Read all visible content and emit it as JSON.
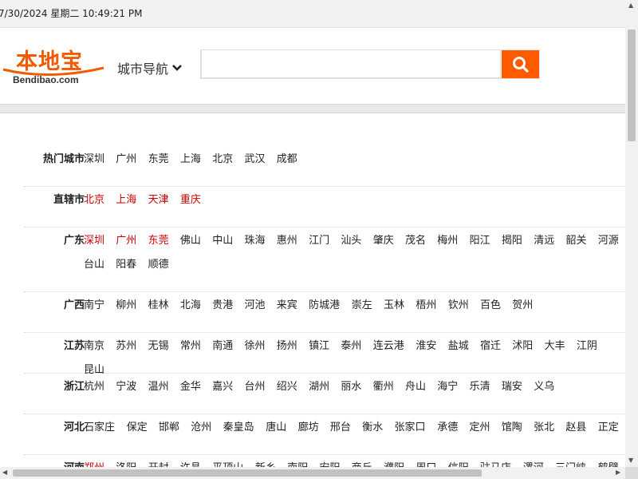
{
  "datetime": "7/30/2024 星期二 10:49:21 PM",
  "logo": {
    "cn": "本地宝",
    "en": "Bendibao.com"
  },
  "nav": {
    "city_nav_label": "城市导航"
  },
  "search": {
    "placeholder": "",
    "value": ""
  },
  "colors": {
    "accent": "#ff5a00",
    "logo": "#f05a00",
    "highlight": "#cc0000"
  },
  "rows": [
    {
      "province": "热门城市",
      "cities": [
        {
          "name": "深圳",
          "red": false
        },
        {
          "name": "广州",
          "red": false
        },
        {
          "name": "东莞",
          "red": false
        },
        {
          "name": "上海",
          "red": false
        },
        {
          "name": "北京",
          "red": false
        },
        {
          "name": "武汉",
          "red": false
        },
        {
          "name": "成都",
          "red": false
        }
      ]
    },
    {
      "province": "直辖市",
      "cities": [
        {
          "name": "北京",
          "red": true
        },
        {
          "name": "上海",
          "red": true
        },
        {
          "name": "天津",
          "red": true
        },
        {
          "name": "重庆",
          "red": true
        }
      ]
    },
    {
      "province": "广东",
      "cities": [
        {
          "name": "深圳",
          "red": true
        },
        {
          "name": "广州",
          "red": true
        },
        {
          "name": "东莞",
          "red": true
        },
        {
          "name": "佛山",
          "red": false
        },
        {
          "name": "中山",
          "red": false
        },
        {
          "name": "珠海",
          "red": false
        },
        {
          "name": "惠州",
          "red": false
        },
        {
          "name": "江门",
          "red": false
        },
        {
          "name": "汕头",
          "red": false
        },
        {
          "name": "肇庆",
          "red": false
        },
        {
          "name": "茂名",
          "red": false
        },
        {
          "name": "梅州",
          "red": false
        },
        {
          "name": "阳江",
          "red": false
        },
        {
          "name": "揭阳",
          "red": false
        },
        {
          "name": "清远",
          "red": false
        },
        {
          "name": "韶关",
          "red": false
        },
        {
          "name": "河源",
          "red": false
        },
        {
          "name": "台山",
          "red": false
        },
        {
          "name": "阳春",
          "red": false
        },
        {
          "name": "顺德",
          "red": false
        }
      ]
    },
    {
      "province": "广西",
      "cities": [
        {
          "name": "南宁",
          "red": false
        },
        {
          "name": "柳州",
          "red": false
        },
        {
          "name": "桂林",
          "red": false
        },
        {
          "name": "北海",
          "red": false
        },
        {
          "name": "贵港",
          "red": false
        },
        {
          "name": "河池",
          "red": false
        },
        {
          "name": "来宾",
          "red": false
        },
        {
          "name": "防城港",
          "red": false
        },
        {
          "name": "崇左",
          "red": false
        },
        {
          "name": "玉林",
          "red": false
        },
        {
          "name": "梧州",
          "red": false
        },
        {
          "name": "钦州",
          "red": false
        },
        {
          "name": "百色",
          "red": false
        },
        {
          "name": "贺州",
          "red": false
        }
      ]
    },
    {
      "province": "江苏",
      "cities": [
        {
          "name": "南京",
          "red": false
        },
        {
          "name": "苏州",
          "red": false
        },
        {
          "name": "无锡",
          "red": false
        },
        {
          "name": "常州",
          "red": false
        },
        {
          "name": "南通",
          "red": false
        },
        {
          "name": "徐州",
          "red": false
        },
        {
          "name": "扬州",
          "red": false
        },
        {
          "name": "镇江",
          "red": false
        },
        {
          "name": "泰州",
          "red": false
        },
        {
          "name": "连云港",
          "red": false
        },
        {
          "name": "淮安",
          "red": false
        },
        {
          "name": "盐城",
          "red": false
        },
        {
          "name": "宿迁",
          "red": false
        },
        {
          "name": "沭阳",
          "red": false
        },
        {
          "name": "大丰",
          "red": false
        },
        {
          "name": "江阴",
          "red": false
        },
        {
          "name": "昆山",
          "red": false
        }
      ]
    },
    {
      "province": "浙江",
      "cities": [
        {
          "name": "杭州",
          "red": false
        },
        {
          "name": "宁波",
          "red": false
        },
        {
          "name": "温州",
          "red": false
        },
        {
          "name": "金华",
          "red": false
        },
        {
          "name": "嘉兴",
          "red": false
        },
        {
          "name": "台州",
          "red": false
        },
        {
          "name": "绍兴",
          "red": false
        },
        {
          "name": "湖州",
          "red": false
        },
        {
          "name": "丽水",
          "red": false
        },
        {
          "name": "衢州",
          "red": false
        },
        {
          "name": "舟山",
          "red": false
        },
        {
          "name": "海宁",
          "red": false
        },
        {
          "name": "乐清",
          "red": false
        },
        {
          "name": "瑞安",
          "red": false
        },
        {
          "name": "义乌",
          "red": false
        }
      ]
    },
    {
      "province": "河北",
      "cities": [
        {
          "name": "石家庄",
          "red": false
        },
        {
          "name": "保定",
          "red": false
        },
        {
          "name": "邯郸",
          "red": false
        },
        {
          "name": "沧州",
          "red": false
        },
        {
          "name": "秦皇岛",
          "red": false
        },
        {
          "name": "唐山",
          "red": false
        },
        {
          "name": "廊坊",
          "red": false
        },
        {
          "name": "邢台",
          "red": false
        },
        {
          "name": "衡水",
          "red": false
        },
        {
          "name": "张家口",
          "red": false
        },
        {
          "name": "承德",
          "red": false
        },
        {
          "name": "定州",
          "red": false
        },
        {
          "name": "馆陶",
          "red": false
        },
        {
          "name": "张北",
          "red": false
        },
        {
          "name": "赵县",
          "red": false
        },
        {
          "name": "正定",
          "red": false
        }
      ]
    },
    {
      "province": "河南",
      "cities": [
        {
          "name": "郑州",
          "red": true
        },
        {
          "name": "洛阳",
          "red": false
        },
        {
          "name": "开封",
          "red": false
        },
        {
          "name": "许昌",
          "red": false
        },
        {
          "name": "平顶山",
          "red": false
        },
        {
          "name": "新乡",
          "red": false
        },
        {
          "name": "南阳",
          "red": false
        },
        {
          "name": "安阳",
          "red": false
        },
        {
          "name": "商丘",
          "red": false
        },
        {
          "name": "濮阳",
          "red": false
        },
        {
          "name": "周口",
          "red": false
        },
        {
          "name": "信阳",
          "red": false
        },
        {
          "name": "驻马店",
          "red": false
        },
        {
          "name": "漯河",
          "red": false
        },
        {
          "name": "三门峡",
          "red": false
        },
        {
          "name": "鹤壁",
          "red": false
        }
      ]
    }
  ]
}
